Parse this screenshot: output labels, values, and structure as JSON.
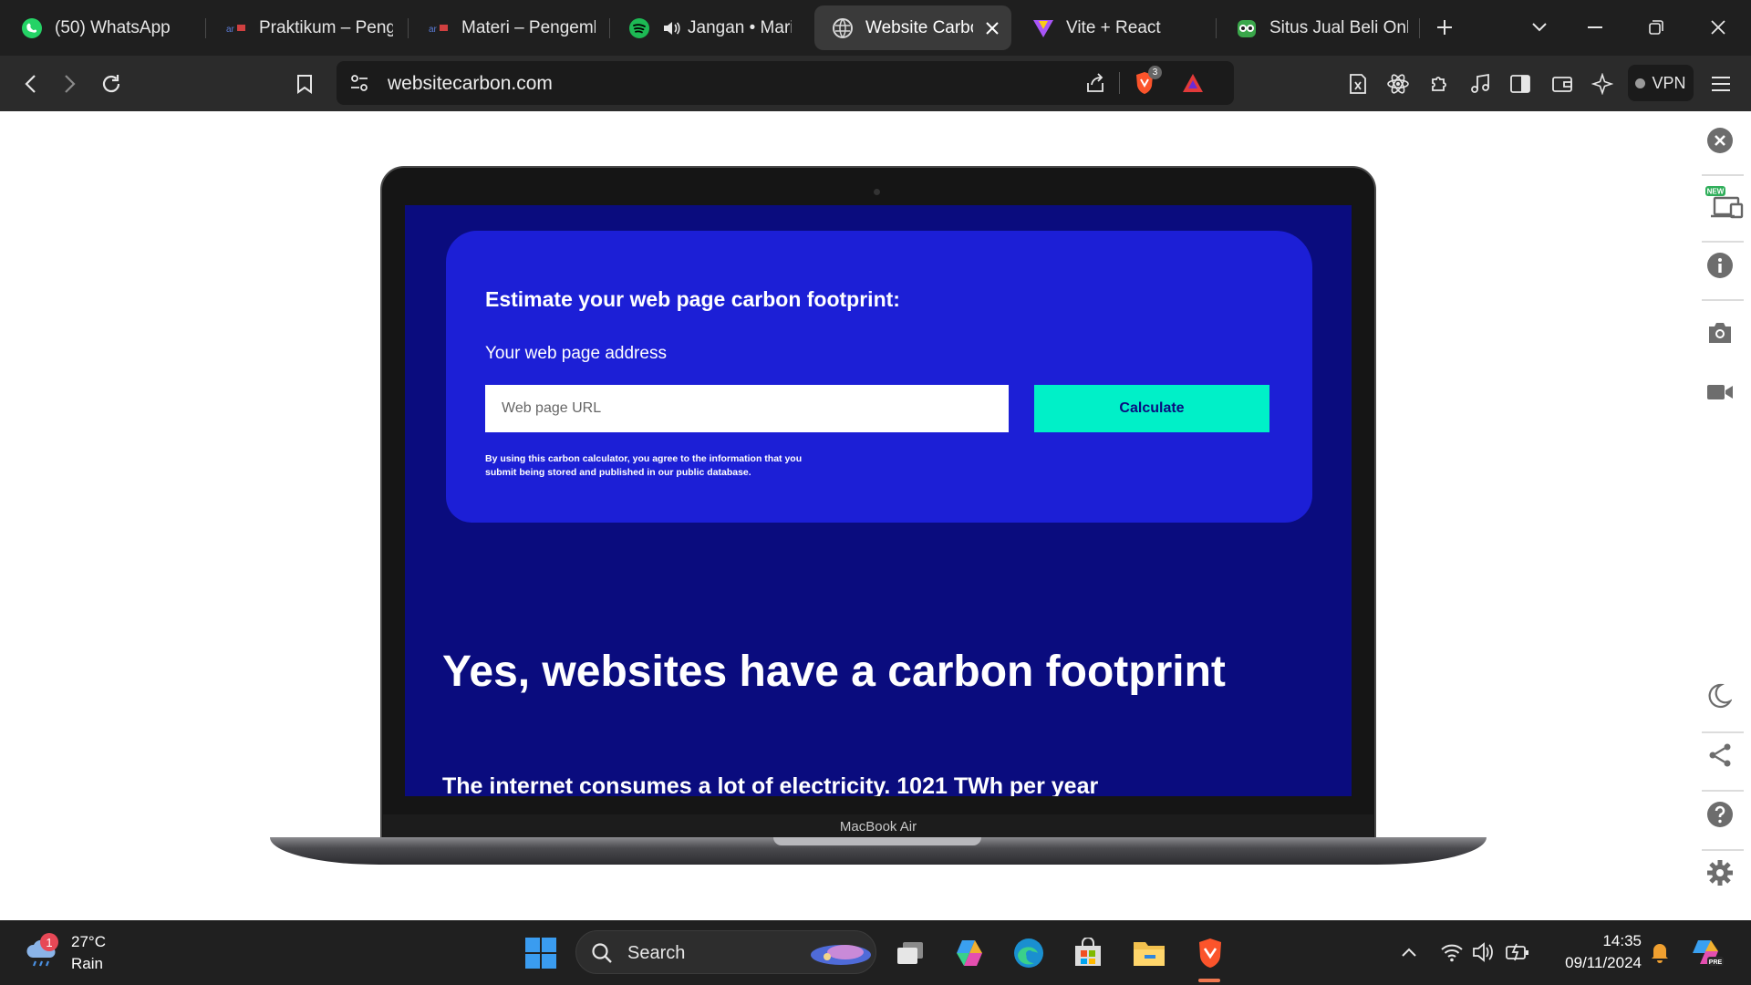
{
  "tabs": [
    {
      "title": "(50) WhatsApp",
      "icon": "whatsapp-icon"
    },
    {
      "title": "Praktikum – Penge",
      "icon": "site-logo-icon"
    },
    {
      "title": "Materi – Pengemb",
      "icon": "site-logo-icon"
    },
    {
      "title": "Jangan • Mario",
      "icon": "spotify-icon"
    },
    {
      "title": "Website Carbo",
      "icon": "globe-icon",
      "active": true
    },
    {
      "title": "Vite + React",
      "icon": "vite-icon"
    },
    {
      "title": "Situs Jual Beli Onli",
      "icon": "owl-icon"
    }
  ],
  "toolbar": {
    "url": "websitecarbon.com",
    "brave_shield_count": "3",
    "vpn_label": "VPN"
  },
  "sidebar": {
    "new_badge": "NEW"
  },
  "laptop": {
    "model_label": "MacBook Air"
  },
  "page": {
    "calc_title": "Estimate your web page carbon footprint:",
    "url_label": "Your web page address",
    "url_placeholder": "Web page URL",
    "calc_button": "Calculate",
    "disclaimer": "By using this carbon calculator, you agree to the information that you submit being stored and published in our public database.",
    "hero_heading": "Yes, websites have a carbon footprint",
    "subheading": "The internet consumes a lot of electricity. 1021 TWh per year"
  },
  "taskbar": {
    "weather_temp": "27°C",
    "weather_cond": "Rain",
    "weather_badge": "1",
    "search_label": "Search",
    "time": "14:35",
    "date": "09/11/2024"
  },
  "colors": {
    "page_bg": "#0a0c7e",
    "card_bg": "#1c1fd6",
    "button_accent": "#00f0c8"
  }
}
